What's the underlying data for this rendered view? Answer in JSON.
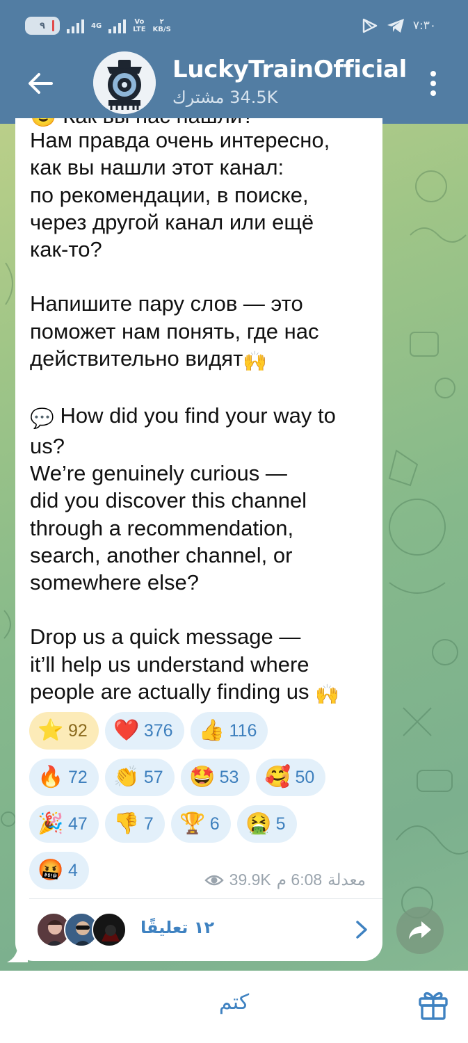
{
  "status_bar": {
    "battery": "٩",
    "network_4g": "4G",
    "volte_top": "Vo",
    "volte_bottom": "LTE",
    "speed_value": "٢",
    "speed_unit": "KB/S",
    "time": "٧:٣٠"
  },
  "header": {
    "channel_name": "LuckyTrainOfficial",
    "subscribers": "34.5K مشترك"
  },
  "message": {
    "cut_line": "😎 Как вы нас нашли?",
    "ru_paragraph_1": "Нам правда очень интересно,\nкак вы нашли этот канал:\nпо рекомендации, в поиске,\nчерез другой канал или ещё\nкак-то?",
    "ru_paragraph_2": "Напишите пару слов — это\nпоможет нам понять, где нас\nдействительно видят",
    "ru_paragraph_2_emoji": "🙌",
    "en_paragraph_1_emoji": "💬",
    "en_paragraph_1": "How did you find your way to\nus?\nWe’re genuinely curious —\ndid you discover this channel\nthrough a recommendation,\nsearch, another channel, or\nsomewhere else?",
    "en_paragraph_2": "Drop us a quick message —\nit’ll help us understand where\npeople are actually finding us",
    "en_paragraph_2_emoji": "🙌"
  },
  "reactions": [
    [
      {
        "emoji": "⭐",
        "count": "92",
        "active": true
      },
      {
        "emoji": "❤️",
        "count": "376"
      },
      {
        "emoji": "👍",
        "count": "116"
      }
    ],
    [
      {
        "emoji": "🔥",
        "count": "72"
      },
      {
        "emoji": "👏",
        "count": "57"
      },
      {
        "emoji": "🤩",
        "count": "53"
      },
      {
        "emoji": "🥰",
        "count": "50"
      }
    ],
    [
      {
        "emoji": "🎉",
        "count": "47"
      },
      {
        "emoji": "👎",
        "count": "7"
      },
      {
        "emoji": "🏆",
        "count": "6"
      },
      {
        "emoji": "🤮",
        "count": "5"
      }
    ],
    [
      {
        "emoji": "🤬",
        "count": "4"
      }
    ]
  ],
  "meta": {
    "views": "39.9K",
    "time": "6:08 م",
    "edited": "معدلة"
  },
  "comments": {
    "label": "١٢ تعليقًا"
  },
  "bottom_bar": {
    "mute_label": "كتم"
  },
  "icons": {
    "back": "back-arrow-icon",
    "menu": "more-vert-icon",
    "views": "eye-icon",
    "share": "share-arrow-icon",
    "gift": "gift-icon"
  },
  "colors": {
    "header": "#527da3",
    "accent": "#3f82c1",
    "reaction_bg": "#e3f0fa",
    "reaction_active_bg": "#fcebb8"
  }
}
